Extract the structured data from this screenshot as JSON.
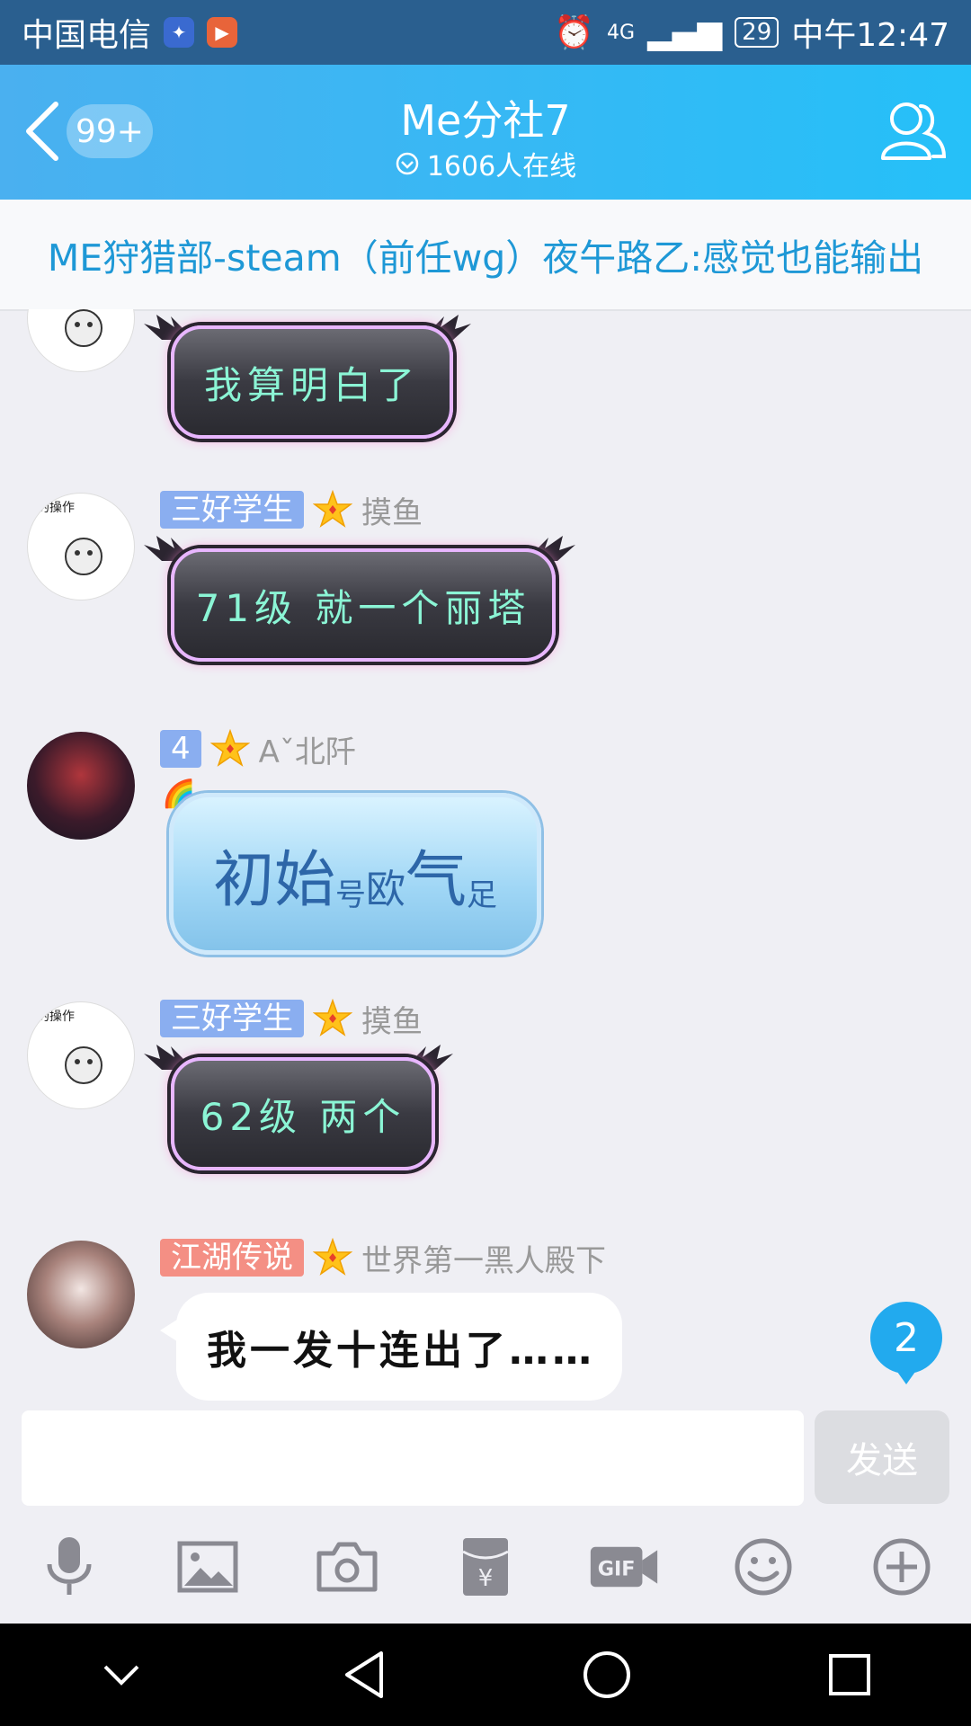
{
  "status_bar": {
    "carrier": "中国电信",
    "network": "4G",
    "battery": "29",
    "time": "中午12:47"
  },
  "header": {
    "unread_badge": "99+",
    "title": "Me分社7",
    "online": "1606人在线"
  },
  "notice": {
    "text": "ME狩猎部-steam（前任wg）夜午路乙:感觉也能输出"
  },
  "messages": [
    {
      "text": "我算明白了"
    },
    {
      "tag": "三好学生",
      "nickname": "摸鱼",
      "text": "71级 就一个丽塔"
    },
    {
      "tag": "4",
      "nickname": "Aˇ北阡",
      "text_parts": [
        "初始",
        "号",
        "欧",
        "气",
        "足"
      ]
    },
    {
      "tag": "三好学生",
      "nickname": "摸鱼",
      "text": "62级 两个"
    },
    {
      "tag": "江湖传说",
      "nickname": "世界第一黑人殿下",
      "text": "我一发十连出了……"
    }
  ],
  "new_message_count": "2",
  "input": {
    "value": "",
    "send_label": "发送"
  },
  "toolbar": {
    "gif_label": "GIF"
  },
  "colors": {
    "header_start": "#4ab0f0",
    "header_end": "#25c0f8",
    "notice_text": "#1e98d6",
    "tag_blue": "#8aaef0",
    "tag_red": "#f48f84"
  }
}
